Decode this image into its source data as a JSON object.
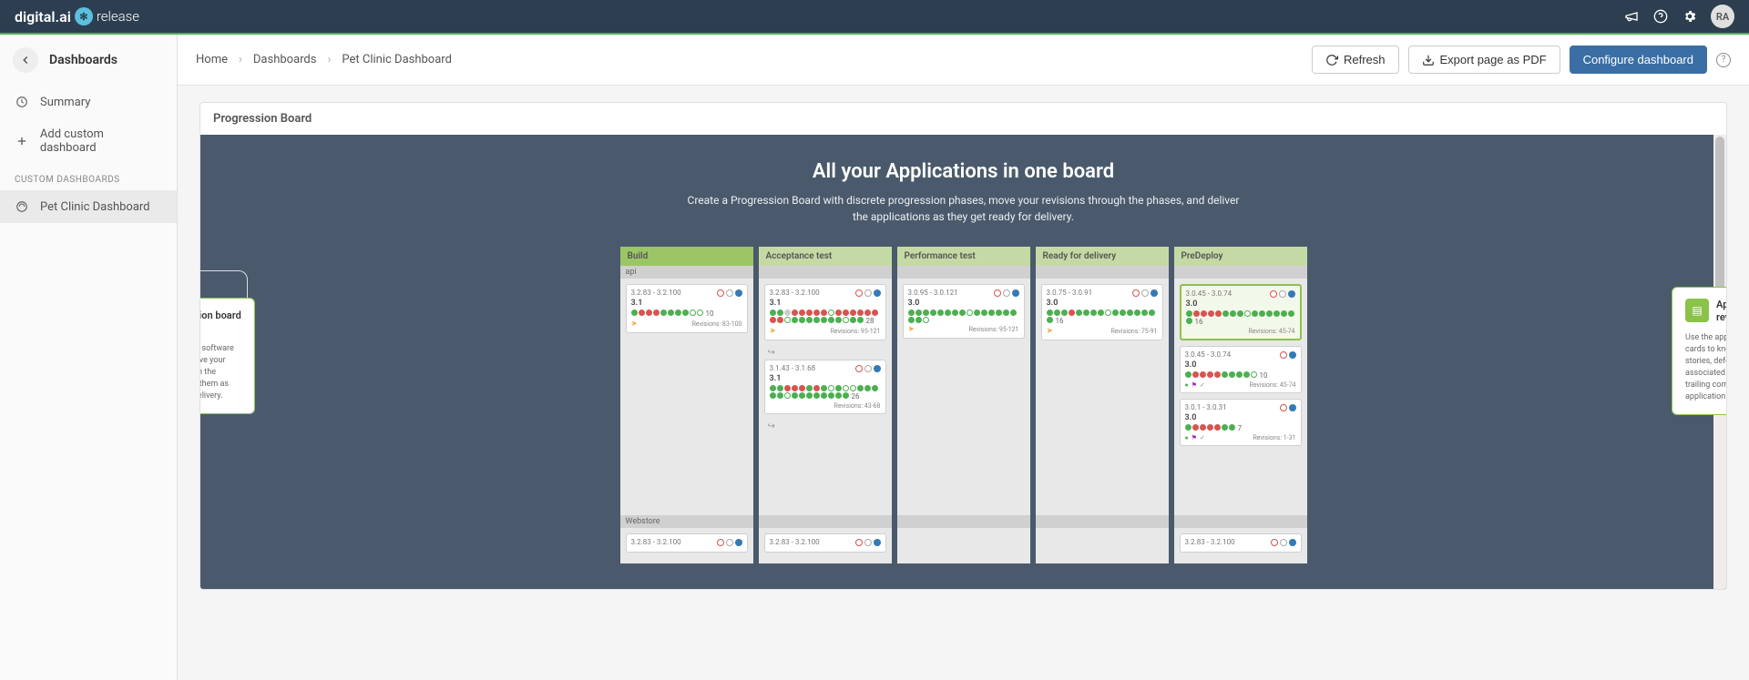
{
  "brand": {
    "name": "digital.ai",
    "product": "release"
  },
  "user": {
    "initials": "RA"
  },
  "sidebar": {
    "title": "Dashboards",
    "items": {
      "summary": "Summary",
      "add_custom": "Add custom dashboard"
    },
    "section_label": "CUSTOM DASHBOARDS",
    "custom": {
      "pet_clinic": "Pet Clinic Dashboard"
    }
  },
  "breadcrumb": {
    "home": "Home",
    "dashboards": "Dashboards",
    "current": "Pet Clinic Dashboard"
  },
  "actions": {
    "refresh": "Refresh",
    "export": "Export page as PDF",
    "configure": "Configure dashboard"
  },
  "widget_title": "Progression Board",
  "intro": {
    "title": "All your Applications in one board",
    "text": "Create a Progression Board with discrete progression phases, move your revisions through the phases, and deliver the applications as they get ready for delivery."
  },
  "phases": [
    "Build",
    "Acceptance test",
    "Performance test",
    "Ready for delivery",
    "PreDeploy"
  ],
  "apps": [
    "api",
    "Webstore"
  ],
  "callouts": {
    "left": {
      "title": "Progression board phases",
      "text": "Define your discrete software delivery phases, move your applications through the phases, and deliver them as they get ready for delivery."
    },
    "right": {
      "title": "Application revision card",
      "text": "Use the application revision cards to know all about the stories, defects and the associated commits (and trailing commits) in an application revision."
    }
  },
  "revisions": {
    "build_api": {
      "range": "3.2.83 - 3.2.100",
      "version": "3.1",
      "dot_count": "10",
      "footer": "Revisions: 83-100"
    },
    "accept_api_1": {
      "range": "3.2.83 - 3.2.100",
      "version": "3.1",
      "dot_count": "28",
      "footer": "Revisions: 95-121"
    },
    "accept_api_2": {
      "range": "3.1.43 - 3.1.68",
      "version": "3.1",
      "dot_count": "26",
      "footer": "Revisions: 43-68"
    },
    "perf_api": {
      "range": "3.0.95 - 3.0.121",
      "version": "3.0",
      "footer": "Revisions: 95-121"
    },
    "ready_api": {
      "range": "3.0.75 - 3.0.91",
      "version": "3.0",
      "dot_count": "16",
      "footer": "Revisions: 75-91"
    },
    "predeploy_1": {
      "range": "3.0.45 - 3.0.74",
      "version": "3.0",
      "dot_count": "16",
      "footer": "Revisions: 45-74"
    },
    "predeploy_2": {
      "range": "3.0.45 - 3.0.74",
      "version": "3.0",
      "dot_count": "10",
      "footer": "Revisions: 45-74"
    },
    "predeploy_3": {
      "range": "3.0.1 - 3.0.31",
      "version": "3.0",
      "dot_count": "7",
      "footer": "Revisions: 1-31"
    },
    "webstore_build": {
      "range": "3.2.83 - 3.2.100"
    },
    "webstore_accept": {
      "range": "3.2.83 - 3.2.100"
    },
    "webstore_predeploy": {
      "range": "3.2.83 - 3.2.100"
    }
  }
}
